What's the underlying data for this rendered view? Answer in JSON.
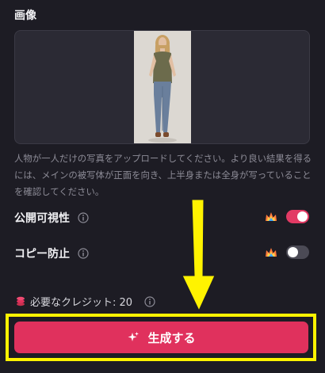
{
  "image_section": {
    "title": "画像"
  },
  "help_text": "人物が一人だけの写真をアップロードしてください。より良い結果を得るには、メインの被写体が正面を向き、上半身または全身が写っていることを確認してください。",
  "settings": [
    {
      "label": "公開可視性",
      "enabled": true
    },
    {
      "label": "コピー防止",
      "enabled": false
    }
  ],
  "credits": {
    "label": "必要なクレジット: 20"
  },
  "generate_button": {
    "label": "生成する"
  },
  "colors": {
    "accent": "#e0315d",
    "highlight": "#fff300",
    "background": "#1d1c24"
  }
}
